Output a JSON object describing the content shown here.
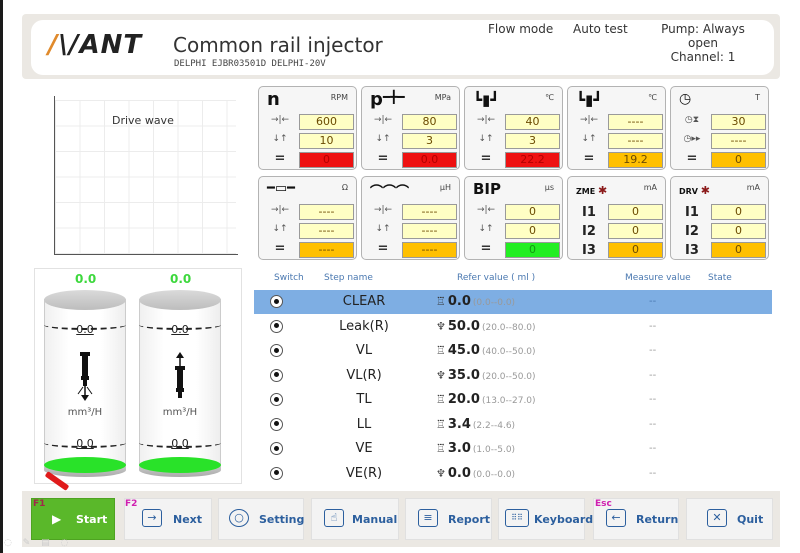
{
  "header": {
    "brand": "AVANT",
    "title": "Common rail injector",
    "subtitle": "DELPHI  EJBR03501D  DELPHI-20V",
    "flow_mode": "Flow mode",
    "auto_test": "Auto test",
    "pump": "Pump: Always open",
    "channel": "Channel: 1"
  },
  "drive_wave": {
    "title": "Drive wave"
  },
  "params": [
    {
      "name": "speed",
      "title": "n",
      "unit": "RPM",
      "set": "600",
      "tolerance": "10",
      "actual": "0",
      "actual_status": "red"
    },
    {
      "name": "pressure",
      "title": "p",
      "unit": "MPa",
      "set": "80",
      "tolerance": "3",
      "actual": "0.0",
      "actual_status": "red"
    },
    {
      "name": "oil-temp",
      "title": "temp",
      "unit": "℃",
      "set": "40",
      "tolerance": "3",
      "actual": "22.2",
      "actual_status": "red"
    },
    {
      "name": "ambient-temp",
      "title": "temp2",
      "unit": "℃",
      "set": "----",
      "tolerance": "----",
      "actual": "19.2",
      "actual_status": "orange"
    },
    {
      "name": "time",
      "title": "clock",
      "unit": "T",
      "set": "30",
      "tolerance": "----",
      "actual": "0",
      "actual_status": "orange"
    },
    {
      "name": "resistance",
      "title": "resistor",
      "unit": "Ω",
      "set": "----",
      "tolerance": "----",
      "actual": "----",
      "actual_status": "orange"
    },
    {
      "name": "inductance",
      "title": "coil",
      "unit": "μH",
      "set": "----",
      "tolerance": "----",
      "actual": "----",
      "actual_status": "orange"
    },
    {
      "name": "bip",
      "title": "BIP",
      "unit": "μs",
      "set": "0",
      "tolerance": "0",
      "actual": "0",
      "actual_status": "green"
    },
    {
      "name": "zme",
      "title": "ZME",
      "unit": "mA",
      "i1": "0",
      "i2": "0",
      "i3": "0"
    },
    {
      "name": "drv",
      "title": "DRV",
      "unit": "mA",
      "i1": "0",
      "i2": "0",
      "i3": "0"
    }
  ],
  "row_labels": {
    "set": "→|←",
    "tolerance": "↓↑",
    "actual": "=",
    "i1": "I1",
    "i2": "I2",
    "i3": "I3"
  },
  "cylinders": [
    {
      "top_value": "0.0",
      "upper_mark": "0.0",
      "lower_mark": "0.0",
      "unit": "mm³/H",
      "direction": "down"
    },
    {
      "top_value": "0.0",
      "upper_mark": "0.0",
      "lower_mark": "0.0",
      "unit": "mm³/H",
      "direction": "up"
    }
  ],
  "table": {
    "headers": {
      "switch": "Switch",
      "step": "Step name",
      "refer": "Refer value ( ml )",
      "measure": "Measure value",
      "state": "State"
    },
    "rows": [
      {
        "step": "CLEAR",
        "icon": "injector-down",
        "value": "0.0",
        "range": "(0.0--0.0)",
        "measure": "--",
        "state": "",
        "selected": true
      },
      {
        "step": "Leak(R)",
        "icon": "injector-up",
        "value": "50.0",
        "range": "(20.0--80.0)",
        "measure": "--",
        "state": ""
      },
      {
        "step": "VL",
        "icon": "injector-down",
        "value": "45.0",
        "range": "(40.0--50.0)",
        "measure": "--",
        "state": ""
      },
      {
        "step": "VL(R)",
        "icon": "injector-up",
        "value": "35.0",
        "range": "(20.0--50.0)",
        "measure": "--",
        "state": ""
      },
      {
        "step": "TL",
        "icon": "injector-down",
        "value": "20.0",
        "range": "(13.0--27.0)",
        "measure": "--",
        "state": ""
      },
      {
        "step": "LL",
        "icon": "injector-down",
        "value": "3.4",
        "range": "(2.2--4.6)",
        "measure": "--",
        "state": ""
      },
      {
        "step": "VE",
        "icon": "injector-down",
        "value": "3.0",
        "range": "(1.0--5.0)",
        "measure": "--",
        "state": ""
      },
      {
        "step": "VE(R)",
        "icon": "injector-up",
        "value": "0.0",
        "range": "(0.0--0.0)",
        "measure": "--",
        "state": ""
      }
    ]
  },
  "toolbar": {
    "start": {
      "label": "Start",
      "fkey": "F1"
    },
    "next": {
      "label": "Next",
      "fkey": "F2"
    },
    "setting": {
      "label": "Setting"
    },
    "manual": {
      "label": "Manual"
    },
    "report": {
      "label": "Report"
    },
    "keyboard": {
      "label": "Keyboard"
    },
    "return": {
      "label": "Return",
      "fkey": "Esc"
    },
    "quit": {
      "label": "Quit"
    }
  },
  "colors": {
    "accent": "#e08a2b",
    "start_green": "#5ab82a",
    "button_text": "#2c5f9e",
    "selected_row": "#7eaee3",
    "fkey": "#d020b0"
  }
}
